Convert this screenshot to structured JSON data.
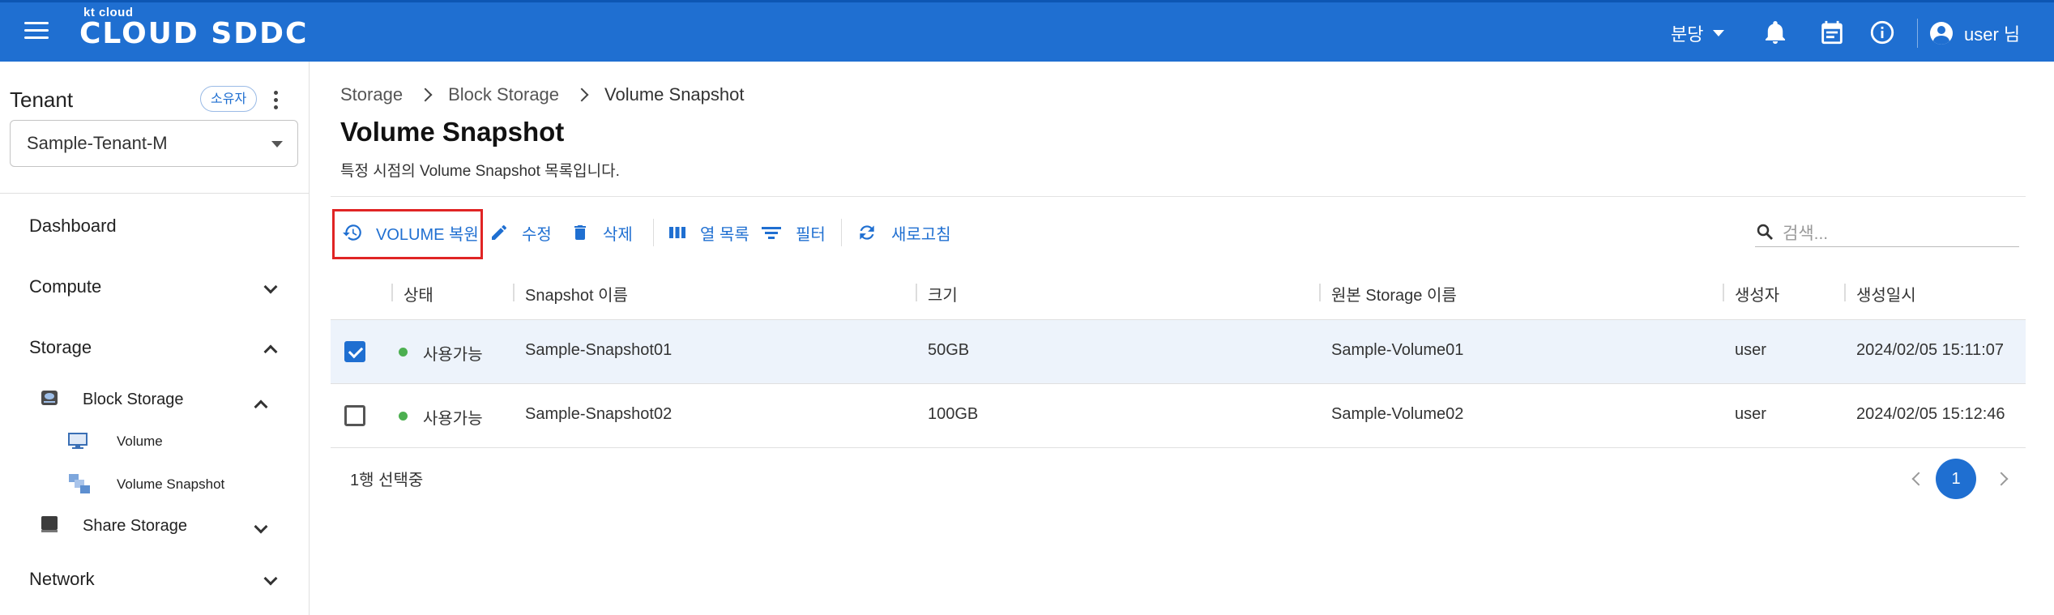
{
  "header": {
    "brand_small": "kt cloud",
    "brand_main": "CLOUD SDDC",
    "language": "분당",
    "user": "user 님",
    "icons": [
      "menu-icon",
      "bell-icon",
      "calendar-icon",
      "info-icon",
      "account-icon"
    ]
  },
  "sidebar": {
    "tenant_label": "Tenant",
    "owner_chip": "소유자",
    "tenant_selected": "Sample-Tenant-M",
    "nav": {
      "dashboard": "Dashboard",
      "compute": "Compute",
      "storage": "Storage",
      "block_storage": "Block Storage",
      "volume": "Volume",
      "volume_snapshot": "Volume Snapshot",
      "share_storage": "Share Storage",
      "network": "Network"
    }
  },
  "breadcrumb": [
    "Storage",
    "Block Storage",
    "Volume Snapshot"
  ],
  "page": {
    "title": "Volume Snapshot",
    "description": "특정 시점의 Volume Snapshot 목록입니다."
  },
  "toolbar": {
    "restore": "VOLUME 복원",
    "edit": "수정",
    "delete": "삭제",
    "columns": "열 목록",
    "filter": "필터",
    "refresh": "새로고침",
    "search_placeholder": "검색..."
  },
  "table": {
    "headers": [
      "상태",
      "Snapshot 이름",
      "크기",
      "원본 Storage 이름",
      "생성자",
      "생성일시"
    ],
    "rows": [
      {
        "selected": true,
        "status": "사용가능",
        "name": "Sample-Snapshot01",
        "size": "50GB",
        "source": "Sample-Volume01",
        "creator": "user",
        "created": "2024/02/05 15:11:07"
      },
      {
        "selected": false,
        "status": "사용가능",
        "name": "Sample-Snapshot02",
        "size": "100GB",
        "source": "Sample-Volume02",
        "creator": "user",
        "created": "2024/02/05 15:12:46"
      }
    ],
    "status_color": "#4caf50"
  },
  "footer": {
    "selection_text": "1행 선택중",
    "current_page": "1"
  },
  "colors": {
    "primary": "#1f6fd1",
    "highlight": "#e02424"
  }
}
